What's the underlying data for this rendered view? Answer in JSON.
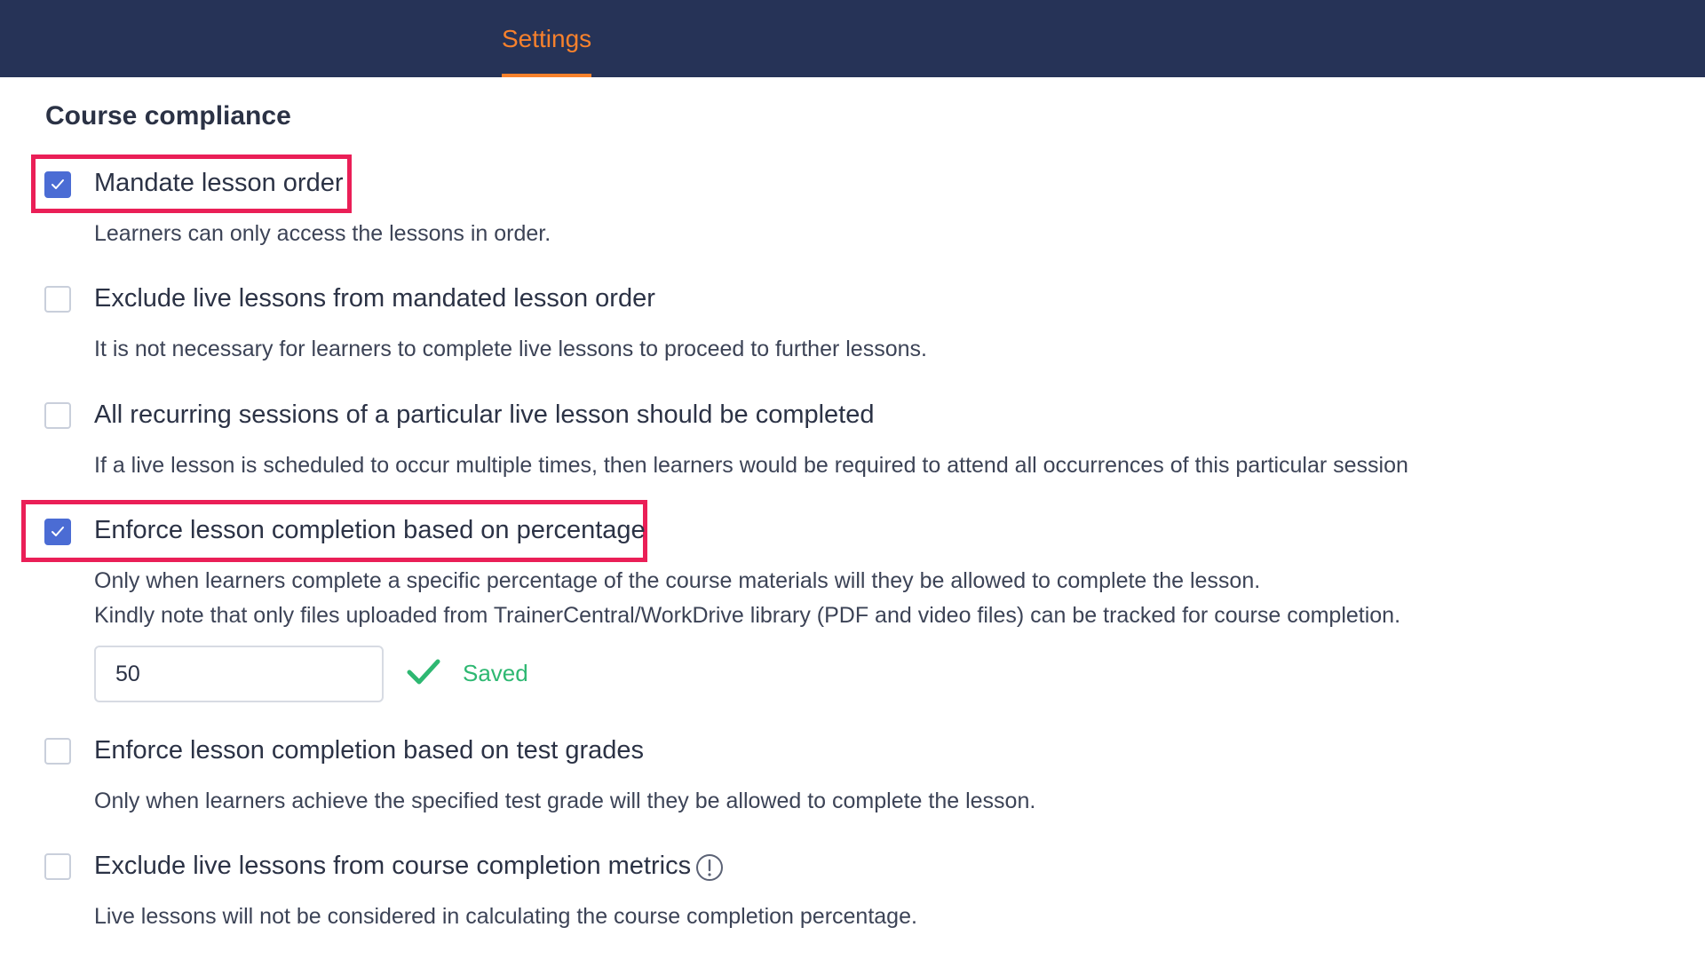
{
  "header": {
    "tab_settings": "Settings",
    "accent_color": "#f7812c",
    "background_color": "#263357"
  },
  "section": {
    "title": "Course compliance"
  },
  "options": [
    {
      "label": "Mandate lesson order",
      "description": "Learners can only access the lessons in order.",
      "checked": true,
      "highlighted": true
    },
    {
      "label": "Exclude live lessons from mandated lesson order",
      "description": "It is not necessary for learners to complete live lessons to proceed to further lessons.",
      "checked": false,
      "highlighted": false
    },
    {
      "label": "All recurring sessions of a particular live lesson should be completed",
      "description": "If a live lesson is scheduled to occur multiple times, then learners would be required to attend all occurrences of this particular session",
      "checked": false,
      "highlighted": false
    },
    {
      "label": "Enforce lesson completion based on percentage",
      "description": "Only when learners complete a specific percentage of the course materials will they be allowed to complete the lesson.",
      "description_2": "Kindly note that only files uploaded from TrainerCentral/WorkDrive library (PDF and video files) can be tracked for course completion.",
      "checked": true,
      "highlighted": true,
      "input_value": "50",
      "status_text": "Saved",
      "status_icon": "check-icon"
    },
    {
      "label": "Enforce lesson completion based on test grades",
      "description": "Only when learners achieve the specified test grade will they be allowed to complete the lesson.",
      "checked": false,
      "highlighted": false
    },
    {
      "label": "Exclude live lessons from course completion metrics",
      "description": "Live lessons will not be considered in calculating the course completion percentage.",
      "checked": false,
      "highlighted": false,
      "info_icon": "info-icon"
    }
  ],
  "colors": {
    "checkbox_checked": "#4b6cd4",
    "highlight_border": "#ea1f57",
    "saved_green": "#2eb872"
  }
}
